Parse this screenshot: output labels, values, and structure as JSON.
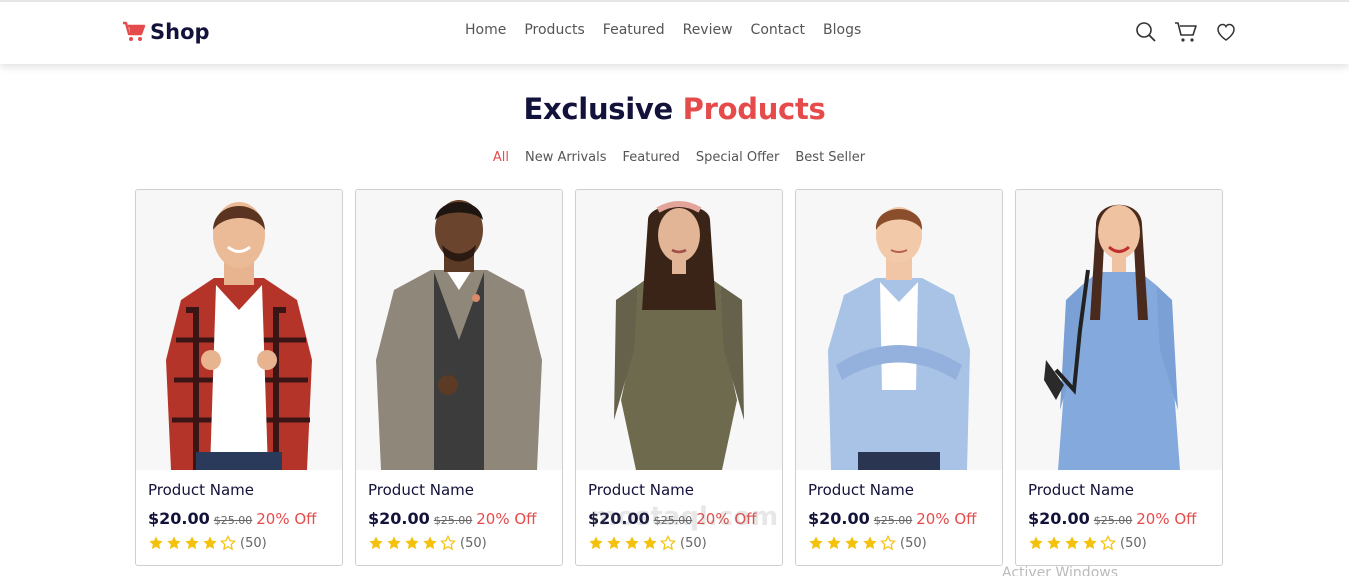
{
  "brand": {
    "name": "Shop",
    "accent": "#e54b4b"
  },
  "nav": {
    "links": [
      "Home",
      "Products",
      "Featured",
      "Review",
      "Contact",
      "Blogs"
    ],
    "icons": [
      "search-icon",
      "cart-icon",
      "heart-icon"
    ]
  },
  "section": {
    "title_main": "Exclusive",
    "title_accent": "Products"
  },
  "filters": {
    "items": [
      "All",
      "New Arrivals",
      "Featured",
      "Special Offer",
      "Best Seller"
    ],
    "active": "All"
  },
  "products": [
    {
      "name": "Product Name",
      "price": "$20.00",
      "old_price": "$25.00",
      "discount": "20% Off",
      "rating": 4,
      "reviews": "(50)",
      "image": "man-plaid-shirt"
    },
    {
      "name": "Product Name",
      "price": "$20.00",
      "old_price": "$25.00",
      "discount": "20% Off",
      "rating": 4,
      "reviews": "(50)",
      "image": "man-tweed-blazer"
    },
    {
      "name": "Product Name",
      "price": "$20.00",
      "old_price": "$25.00",
      "discount": "20% Off",
      "rating": 4,
      "reviews": "(50)",
      "image": "woman-olive-dress"
    },
    {
      "name": "Product Name",
      "price": "$20.00",
      "old_price": "$25.00",
      "discount": "20% Off",
      "rating": 4,
      "reviews": "(50)",
      "image": "boy-blue-shirt"
    },
    {
      "name": "Product Name",
      "price": "$20.00",
      "old_price": "$25.00",
      "discount": "20% Off",
      "rating": 4,
      "reviews": "(50)",
      "image": "girl-blue-dress"
    }
  ],
  "overlay": {
    "watermark": "mostaql.com",
    "os_notice": "Activer Windows"
  },
  "colors": {
    "navy": "#12123a",
    "red": "#e54b4b",
    "star": "#f4c20d"
  }
}
